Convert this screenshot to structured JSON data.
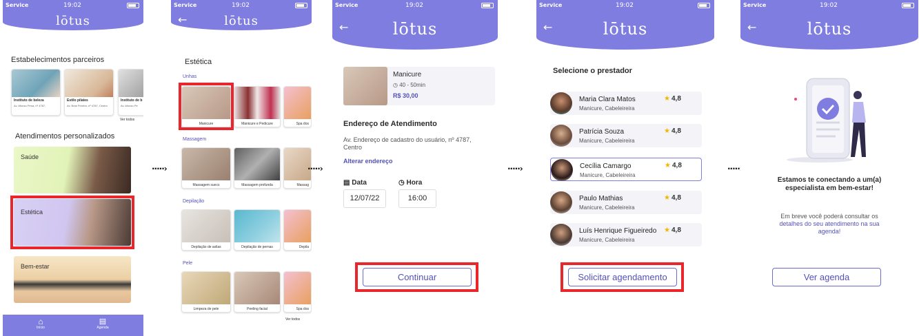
{
  "status": {
    "carrier": "Service",
    "time": "19:02"
  },
  "brand": "lōtus",
  "arrows": "·····›",
  "screen1": {
    "partners_title": "Estabelecimentos parceiros",
    "partners": [
      {
        "name": "Instituto de beleza",
        "addr": "Av. Afonso Pena, nº 4787,"
      },
      {
        "name": "Estilo pilates",
        "addr": "Av. Brás Pereira, nº 4787, Centro"
      },
      {
        "name": "Instituto de b",
        "addr": "Av. Afonso Pe"
      }
    ],
    "see_all": "Ver todos",
    "custom_title": "Atendimentos personalizados",
    "categories": [
      "Saúde",
      "Estética",
      "Bem-estar"
    ],
    "nav": [
      {
        "label": "Início",
        "icon": "home-icon"
      },
      {
        "label": "Agenda",
        "icon": "calendar-icon"
      }
    ]
  },
  "screen2": {
    "title": "Estética",
    "sections": [
      {
        "name": "Unhas",
        "items": [
          "Manicure",
          "Manicure e Pedicure",
          "Spa dos"
        ]
      },
      {
        "name": "Massagem",
        "items": [
          "Massagem suecs",
          "Massagem profunda",
          "Massag"
        ]
      },
      {
        "name": "Depilação",
        "items": [
          "Depilação de axilas",
          "Depilação de pernas",
          "Depila"
        ]
      },
      {
        "name": "Pele",
        "items": [
          "Limpeza de pele",
          "Peeling facial",
          "Spa dos"
        ]
      }
    ],
    "see_all": "Ver todos"
  },
  "screen3": {
    "service": "Manicure",
    "duration": "40 - 50min",
    "price": "R$ 30,00",
    "address_title": "Endereço de Atendimento",
    "address": "Av. Endereço de cadastro do usuário, nº 4787,",
    "address2": "Centro",
    "change_address": "Alterar endereço",
    "date_label": "Data",
    "date_value": "12/07/22",
    "time_label": "Hora",
    "time_value": "16:00",
    "continue": "Continuar"
  },
  "screen4": {
    "title": "Selecione o prestador",
    "providers": [
      {
        "name": "Maria Clara Matos",
        "spec": "Manicure, Cabeleireira",
        "rating": "4,8"
      },
      {
        "name": "Patrícia Souza",
        "spec": "Manicure, Cabeleireira",
        "rating": "4,8"
      },
      {
        "name": "Cecília Camargo",
        "spec": "Manicure, Cabeleireira",
        "rating": "4,8"
      },
      {
        "name": "Paulo Mathias",
        "spec": "Manicure, Cabeleireira",
        "rating": "4,8"
      },
      {
        "name": "Luís Henrique Figueiredo",
        "spec": "Manicure, Cabeleireira",
        "rating": "4,8"
      }
    ],
    "request": "Solicitar agendamento"
  },
  "screen5": {
    "headline1": "Estamos te conectando a um(a)",
    "headline2": "especialista em bem-estar!",
    "info1": "Em breve você poderá consultar os",
    "info2": "detalhes do seu atendimento na sua",
    "info3": "agenda!",
    "button": "Ver agenda"
  },
  "colors": {
    "primary": "#7f7de0",
    "highlight": "#e8262b",
    "accent_text": "#5351b8"
  }
}
